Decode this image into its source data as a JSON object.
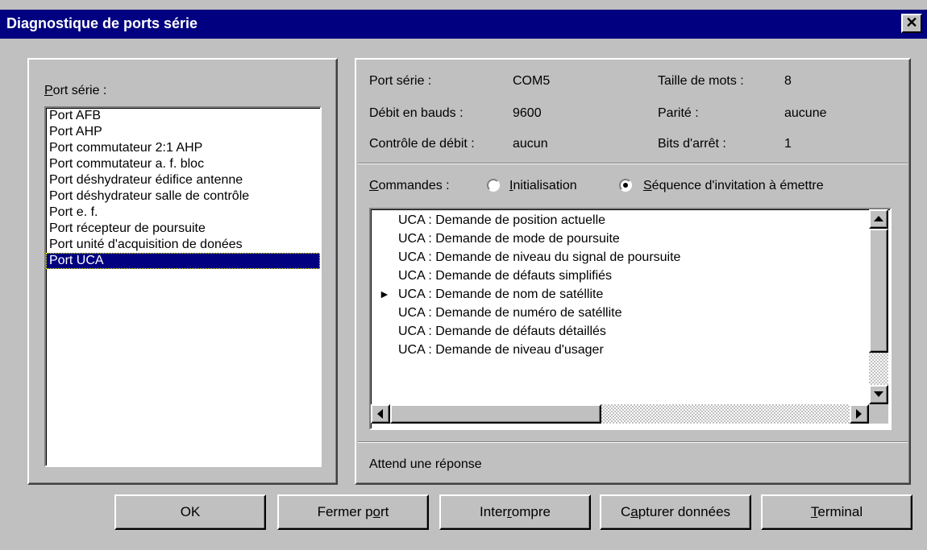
{
  "window": {
    "title": "Diagnostique de ports série",
    "close_glyph": "✕"
  },
  "left": {
    "label_pre": "",
    "label_accel": "P",
    "label_post": "ort série :",
    "ports": [
      "Port AFB",
      "Port AHP",
      "Port commutateur 2:1 AHP",
      "Port commutateur a. f. bloc",
      "Port déshydrateur édifice antenne",
      "Port déshydrateur salle de contrôle",
      "Port e. f.",
      "Port récepteur de poursuite",
      "Port unité d'acquisition de donées",
      "Port UCA"
    ],
    "selected_index": 9
  },
  "info": {
    "port_label": "Port série :",
    "port_value": "COM5",
    "baud_label": "Débit en bauds :",
    "baud_value": "9600",
    "flow_label": "Contrôle de débit :",
    "flow_value": "aucun",
    "word_label": "Taille de mots :",
    "word_value": "8",
    "parity_label": "Parité :",
    "parity_value": "aucune",
    "stop_label": "Bits d'arrêt :",
    "stop_value": "1"
  },
  "commands": {
    "label_accel": "C",
    "label_post": "ommandes :",
    "radio1_accel": "I",
    "radio1_post": "nitialisation",
    "radio2_accel": "S",
    "radio2_post": "équence d'invitation à émettre",
    "selected_radio": 2,
    "items": [
      "UCA : Demande de position actuelle",
      "UCA : Demande de mode de poursuite",
      "UCA : Demande de niveau du signal de poursuite",
      "UCA : Demande de défauts simplifiés",
      "UCA : Demande de nom de satéllite",
      "UCA : Demande de numéro de satéllite",
      "UCA : Demande de défauts détaillés",
      "UCA : Demande de niveau d'usager"
    ],
    "current_index": 4,
    "current_glyph": "►"
  },
  "status": "Attend une réponse",
  "buttons": {
    "ok": "OK",
    "close_pre": "Fermer p",
    "close_accel": "o",
    "close_post": "rt",
    "interrupt_pre": "Inter",
    "interrupt_accel": "r",
    "interrupt_post": "ompre",
    "capture_pre": "C",
    "capture_accel": "a",
    "capture_post": "pturer données",
    "terminal_pre": "",
    "terminal_accel": "T",
    "terminal_post": "erminal"
  },
  "icons": {
    "close": "close-icon",
    "scroll_up": "arrow-up-icon",
    "scroll_down": "arrow-down-icon",
    "scroll_left": "arrow-left-icon",
    "scroll_right": "arrow-right-icon",
    "current_row": "pointer-arrow-icon"
  },
  "colors": {
    "title_bar": "#000080",
    "selection": "#000080",
    "face": "#c0c0c0"
  }
}
